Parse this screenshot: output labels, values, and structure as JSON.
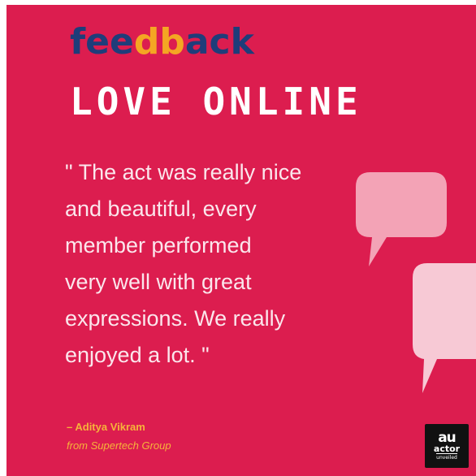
{
  "logo": {
    "letters": [
      {
        "char": "f",
        "color": "#1f3d7a"
      },
      {
        "char": "e",
        "color": "#1f3d7a"
      },
      {
        "char": "e",
        "color": "#1f3d7a"
      },
      {
        "char": "d",
        "color": "#f4a623"
      },
      {
        "char": "b",
        "color": "#f4a623"
      },
      {
        "char": "a",
        "color": "#1f3d7a"
      },
      {
        "char": "c",
        "color": "#1f3d7a"
      },
      {
        "char": "k",
        "color": "#1f3d7a"
      }
    ]
  },
  "headline": "LOVE ONLINE",
  "quote": {
    "lines": [
      "\" The act was really nice",
      "and beautiful, every",
      "member performed",
      "very well with great",
      "expressions. We really",
      "enjoyed a lot. \""
    ]
  },
  "attribution": {
    "name": "– Aditya Vikram",
    "organization": "from Supertech Group"
  },
  "brand": {
    "mark": "au",
    "name": "actor",
    "tagline": "unveiled"
  },
  "colors": {
    "background": "#dc1d4f",
    "bubble_1": "#f3a3b6",
    "bubble_2": "#f7c9d5",
    "attribution": "#f6b33a"
  },
  "icons": {
    "bubble_1": "speech-bubble-icon",
    "bubble_2": "speech-bubble-icon"
  }
}
